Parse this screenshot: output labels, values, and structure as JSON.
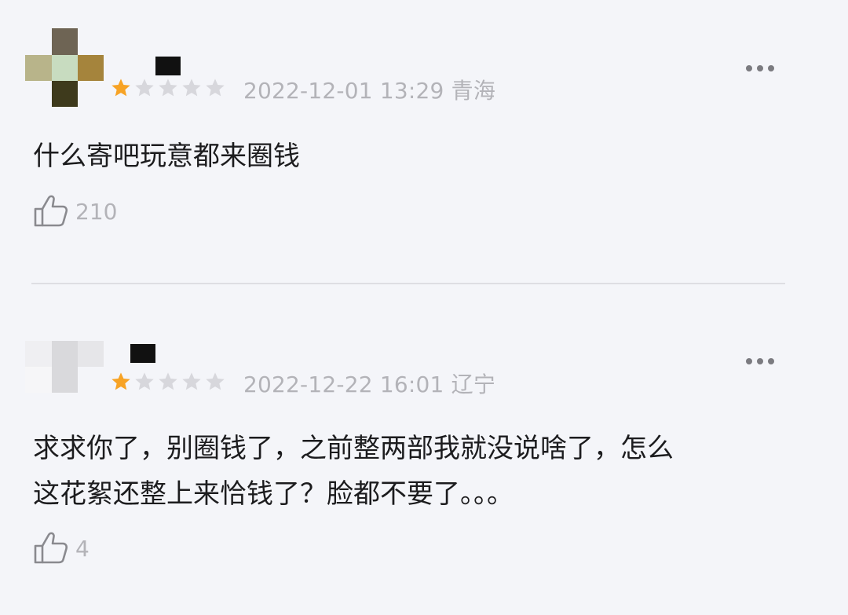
{
  "reviews": [
    {
      "rating": 1,
      "max_rating": 5,
      "date": "2022-12-01 13:29",
      "region": "青海",
      "text": "什么寄吧玩意都来圈钱",
      "likes": "210"
    },
    {
      "rating": 1,
      "max_rating": 5,
      "date": "2022-12-22 16:01",
      "region": "辽宁",
      "text_lines": [
        "求求你了，别圈钱了，之前整两部我就没说啥了，怎么",
        "这花絮还整上来恰钱了？脸都不要了。。。"
      ],
      "likes": "4"
    }
  ],
  "colors": {
    "star_filled": "#f7a325",
    "star_empty": "#d7d7dc",
    "background": "#f4f5f9"
  }
}
